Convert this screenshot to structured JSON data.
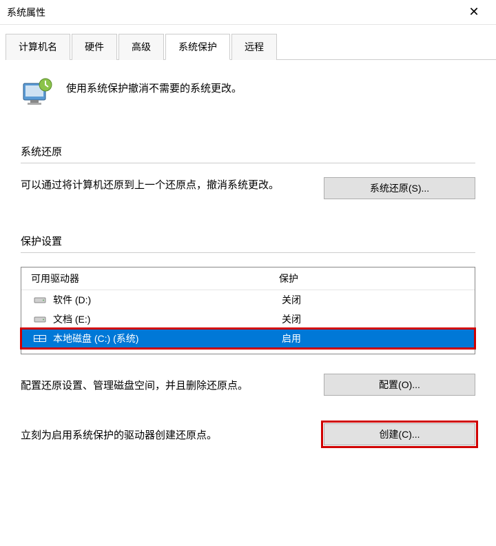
{
  "window": {
    "title": "系统属性"
  },
  "tabs": {
    "computer_name": "计算机名",
    "hardware": "硬件",
    "advanced": "高级",
    "system_protection": "系统保护",
    "remote": "远程"
  },
  "intro": {
    "text": "使用系统保护撤消不需要的系统更改。"
  },
  "restore": {
    "section_title": "系统还原",
    "description": "可以通过将计算机还原到上一个还原点，撤消系统更改。",
    "button": "系统还原(S)..."
  },
  "protection": {
    "section_title": "保护设置",
    "col_drive": "可用驱动器",
    "col_status": "保护",
    "drives": [
      {
        "name": "软件 (D:)",
        "status": "关闭",
        "selected": false
      },
      {
        "name": "文档 (E:)",
        "status": "关闭",
        "selected": false
      },
      {
        "name": "本地磁盘 (C:) (系统)",
        "status": "启用",
        "selected": true
      }
    ]
  },
  "configure": {
    "text": "配置还原设置、管理磁盘空间，并且删除还原点。",
    "button": "配置(O)..."
  },
  "create": {
    "text": "立刻为启用系统保护的驱动器创建还原点。",
    "button": "创建(C)..."
  }
}
